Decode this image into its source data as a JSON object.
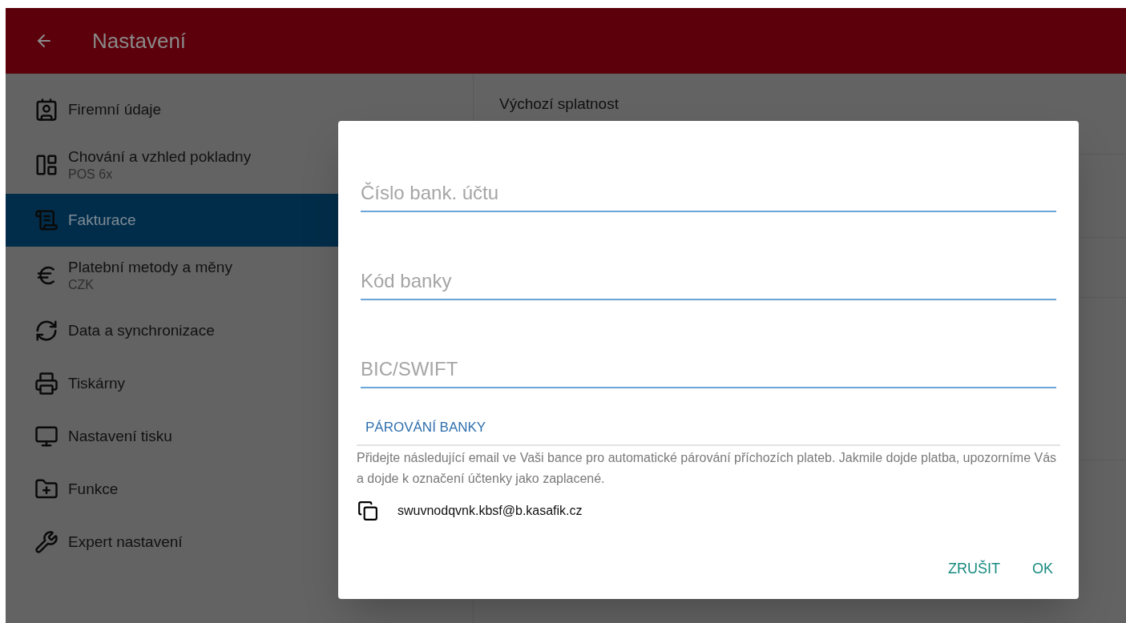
{
  "header": {
    "title": "Nastavení"
  },
  "sidebar": {
    "items": [
      {
        "label": "Firemní údaje",
        "selected": false
      },
      {
        "label": "Chování a vzhled pokladny",
        "subtitle": "POS 6x",
        "selected": false
      },
      {
        "label": "Fakturace",
        "selected": true
      },
      {
        "label": "Platební metody a měny",
        "subtitle": "CZK",
        "selected": false
      },
      {
        "label": "Data a synchronizace",
        "selected": false
      },
      {
        "label": "Tiskárny",
        "selected": false
      },
      {
        "label": "Nastavení tisku",
        "selected": false
      },
      {
        "label": "Funkce",
        "selected": false
      },
      {
        "label": "Expert nastavení",
        "selected": false
      }
    ]
  },
  "detail": {
    "title": "Výchozí splatnost"
  },
  "dialog": {
    "fields": [
      {
        "placeholder": "Číslo bank. účtu"
      },
      {
        "placeholder": "Kód banky"
      },
      {
        "placeholder": "BIC/SWIFT"
      }
    ],
    "section_title": "PÁROVÁNÍ BANKY",
    "description": "Přidejte následující email ve Vaši bance pro automatické párování příchozích plateb. Jakmile dojde platba, upozorníme Vás a dojde k označení účtenky jako zaplacené.",
    "email": "swuvnodqvnk.kbsf@b.kasafik.cz",
    "buttons": [
      "ZRUŠIT",
      "OK"
    ]
  }
}
